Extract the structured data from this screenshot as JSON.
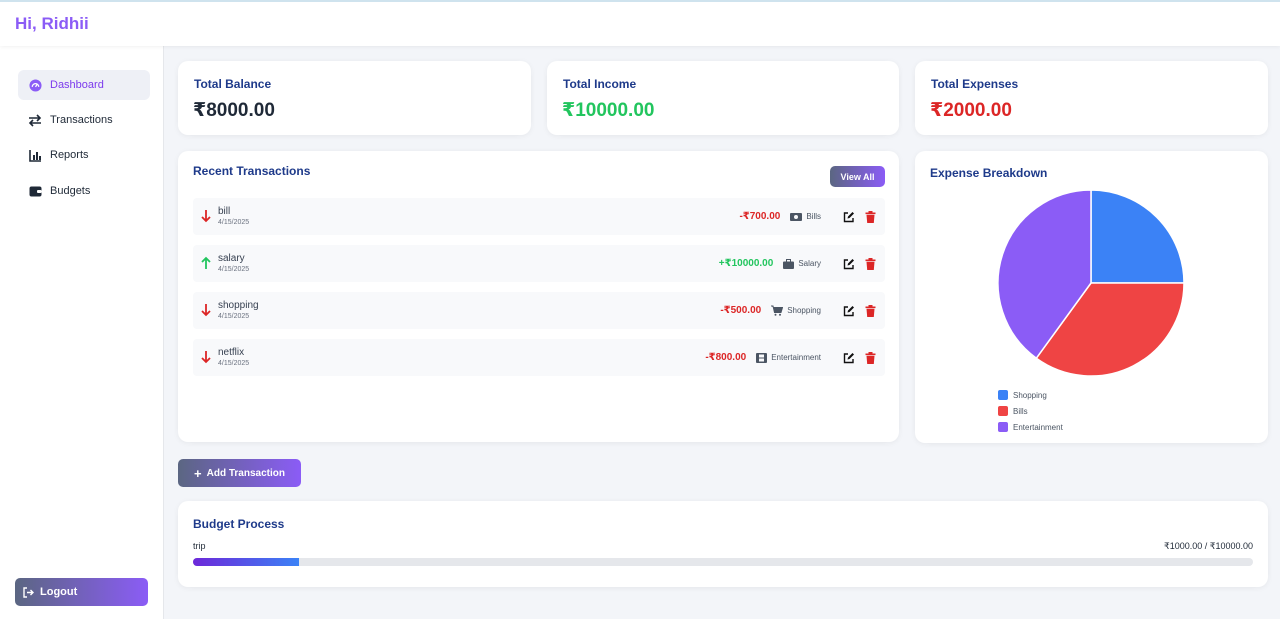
{
  "header": {
    "greeting": "Hi, Ridhii"
  },
  "sidebar": {
    "items": [
      {
        "label": "Dashboard",
        "icon": "dashboard-gauge-icon",
        "active": true
      },
      {
        "label": "Transactions",
        "icon": "exchange-arrows-icon",
        "active": false
      },
      {
        "label": "Reports",
        "icon": "chart-icon",
        "active": false
      },
      {
        "label": "Budgets",
        "icon": "wallet-icon",
        "active": false
      }
    ],
    "logout_label": "Logout"
  },
  "stats": {
    "balance": {
      "title": "Total Balance",
      "value": "₹8000.00",
      "color": "#1f2937"
    },
    "income": {
      "title": "Total Income",
      "value": "₹10000.00",
      "color": "#22c55e"
    },
    "expenses": {
      "title": "Total Expenses",
      "value": "₹2000.00",
      "color": "#dc2626"
    }
  },
  "recent": {
    "title": "Recent Transactions",
    "view_all_label": "View All",
    "transactions": [
      {
        "name": "bill",
        "date": "4/15/2025",
        "amount": "-₹700.00",
        "type": "expense",
        "category": "Bills",
        "category_icon": "money-icon"
      },
      {
        "name": "salary",
        "date": "4/15/2025",
        "amount": "+₹10000.00",
        "type": "income",
        "category": "Salary",
        "category_icon": "briefcase-icon"
      },
      {
        "name": "shopping",
        "date": "4/15/2025",
        "amount": "-₹500.00",
        "type": "expense",
        "category": "Shopping",
        "category_icon": "cart-icon"
      },
      {
        "name": "netflix",
        "date": "4/15/2025",
        "amount": "-₹800.00",
        "type": "expense",
        "category": "Entertainment",
        "category_icon": "film-icon"
      }
    ]
  },
  "actions": {
    "add_transaction_label": "Add Transaction"
  },
  "expense_breakdown": {
    "title": "Expense Breakdown"
  },
  "chart_data": {
    "type": "pie",
    "categories": [
      "Shopping",
      "Bills",
      "Entertainment"
    ],
    "values": [
      500,
      700,
      800
    ],
    "colors": [
      "#3b82f6",
      "#ef4444",
      "#8b5cf6"
    ],
    "legend": "bottom"
  },
  "budget": {
    "title": "Budget Process",
    "items": [
      {
        "label": "trip",
        "amount_text": "₹1000.00 / ₹10000.00",
        "progress": 0.1
      }
    ]
  },
  "colors": {
    "accent": "#8b5cf6",
    "income": "#22c55e",
    "expense": "#dc2626",
    "title": "#1e3a8a"
  }
}
